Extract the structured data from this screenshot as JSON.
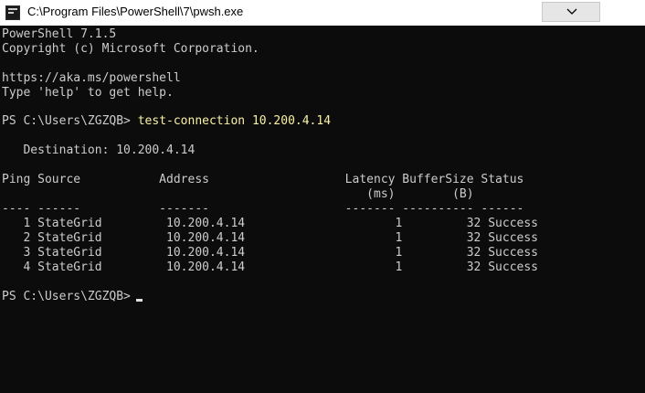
{
  "window": {
    "title": "C:\\Program Files\\PowerShell\\7\\pwsh.exe",
    "app_icon": "powershell-console-icon",
    "dropdown_icon": "chevron-down-icon"
  },
  "console": {
    "banner_version": "PowerShell 7.1.5",
    "banner_copyright": "Copyright (c) Microsoft Corporation.",
    "banner_url": "https://aka.ms/powershell",
    "banner_help": "Type 'help' to get help.",
    "prompt_1": "PS C:\\Users\\ZGZQB> ",
    "command_1": "test-connection 10.200.4.14",
    "destination_line": "   Destination: 10.200.4.14",
    "header_line_1": "Ping Source           Address                   Latency BufferSize Status",
    "header_line_2": "                                                   (ms)        (B)",
    "separator_line": "---- ------           -------                   ------- ---------- ------",
    "rows": [
      "   1 StateGrid         10.200.4.14                     1         32 Success",
      "   2 StateGrid         10.200.4.14                     1         32 Success",
      "   3 StateGrid         10.200.4.14                     1         32 Success",
      "   4 StateGrid         10.200.4.14                     1         32 Success"
    ],
    "prompt_2": "PS C:\\Users\\ZGZQB>"
  },
  "colors": {
    "background": "#0c0c0c",
    "foreground": "#cccccc",
    "command": "#f9f1a5"
  }
}
